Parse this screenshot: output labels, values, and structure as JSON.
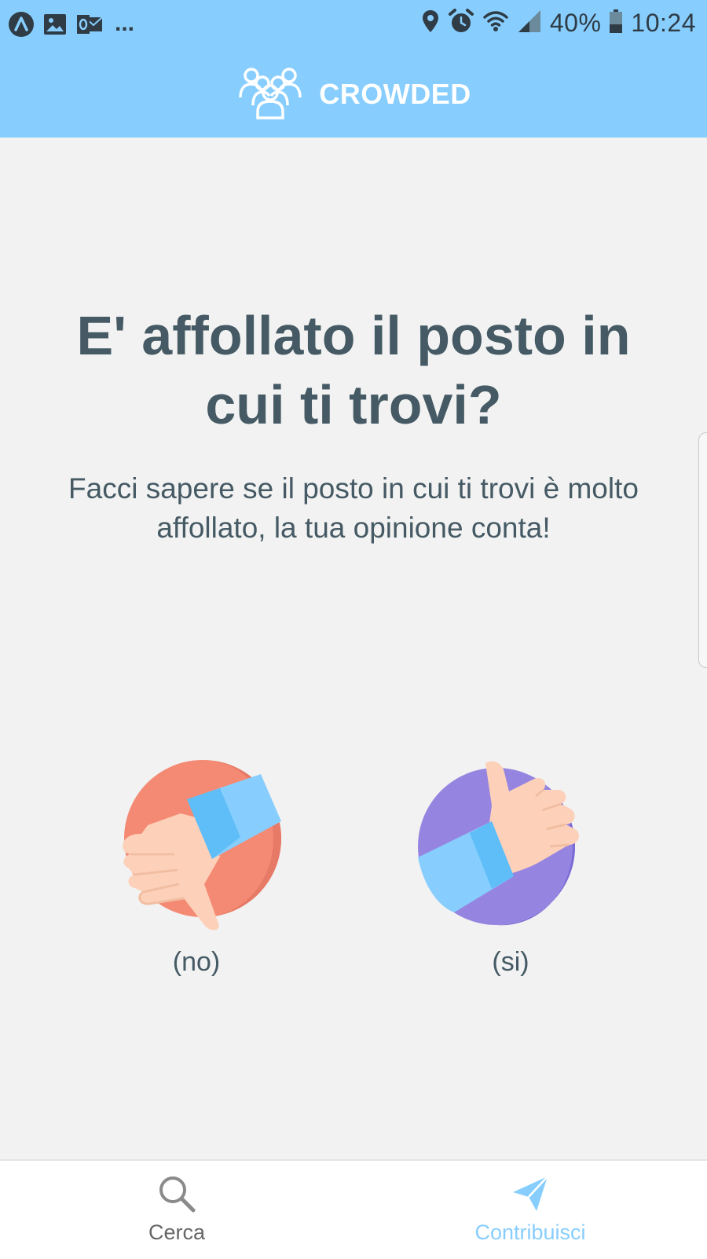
{
  "status_bar": {
    "battery": "40%",
    "time": "10:24",
    "notification_icons": [
      "app-notification-icon",
      "image-icon",
      "outlook-icon"
    ],
    "status_icons": [
      "location-icon",
      "alarm-icon",
      "wifi-icon",
      "signal-icon",
      "battery-icon"
    ],
    "battery_level": 0.4
  },
  "app_bar": {
    "title": "CROWDED",
    "logo_icon": "crowd-icon",
    "background_color": "#87cefe"
  },
  "main": {
    "heading": "E' affollato il posto in cui ti trovi?",
    "subtitle": "Facci sapere se il posto in cui ti trovi è molto affollato, la tua opinione conta!",
    "vote_no": {
      "label": "(no)",
      "icon": "thumbs-down-icon"
    },
    "vote_si": {
      "label": "(si)",
      "icon": "thumbs-up-icon"
    }
  },
  "bottom_nav": {
    "items": [
      {
        "label": "Cerca",
        "icon": "search-icon",
        "active": false
      },
      {
        "label": "Contribuisci",
        "icon": "send-icon",
        "active": true
      }
    ],
    "active_color": "#87cefe"
  },
  "colors": {
    "text": "#455a64",
    "background": "#f2f2f2"
  }
}
